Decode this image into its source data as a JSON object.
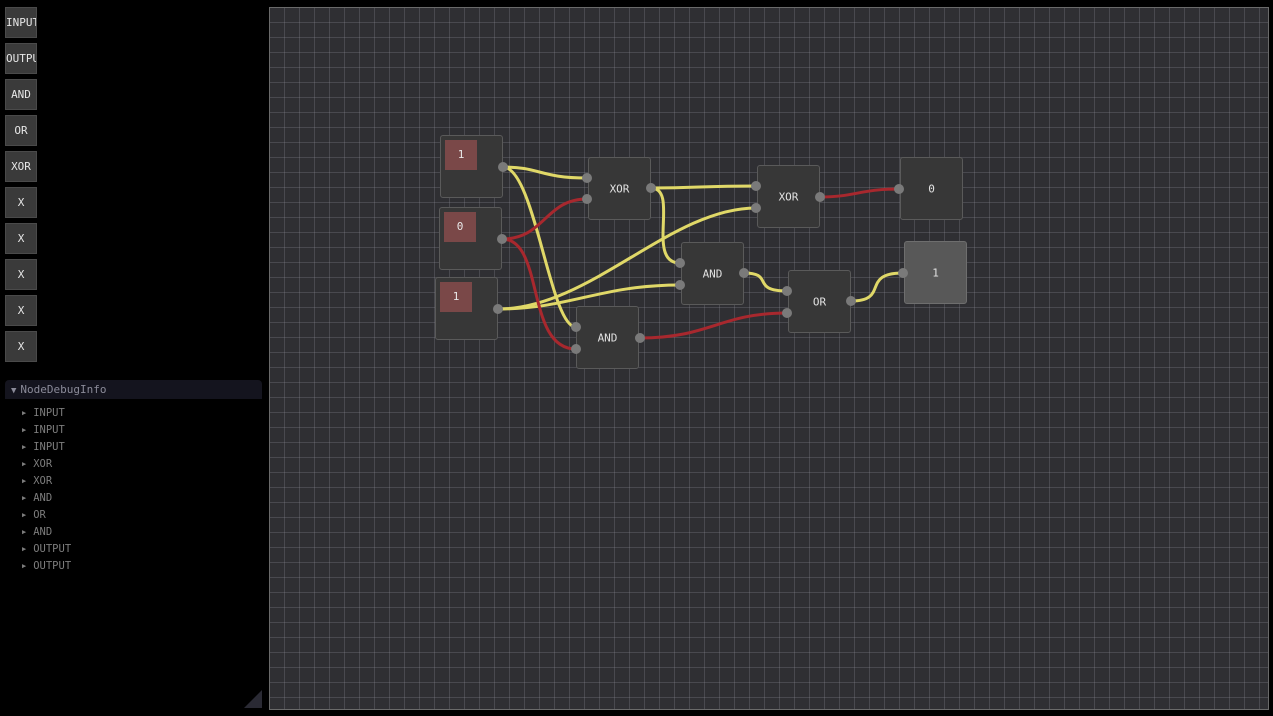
{
  "toolbar": {
    "input": "INPUT",
    "output": "OUTPUT",
    "and": "AND",
    "or": "OR",
    "xor": "XOR",
    "x1": "X",
    "x2": "X",
    "x3": "X",
    "x4": "X",
    "x5": "X"
  },
  "debug": {
    "title": "NodeDebugInfo",
    "items": [
      "INPUT",
      "INPUT",
      "INPUT",
      "XOR",
      "XOR",
      "AND",
      "OR",
      "AND",
      "OUTPUT",
      "OUTPUT"
    ]
  },
  "nodes": {
    "input1": "1",
    "input2": "0",
    "input3": "1",
    "xor1": "XOR",
    "xor2": "XOR",
    "and1": "AND",
    "and2": "AND",
    "or1": "OR",
    "output_sum": "0",
    "output_carry": "1"
  },
  "colors": {
    "wire_high": "#e0d868",
    "wire_low": "#a8282e"
  }
}
